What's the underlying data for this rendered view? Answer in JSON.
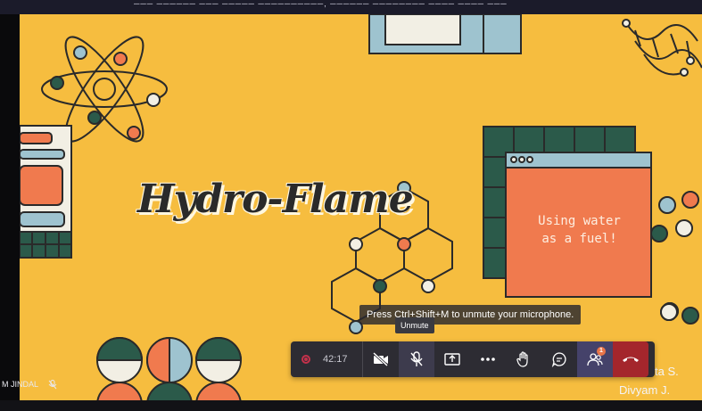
{
  "window": {
    "top_title": "─── ────── ─── ───── ──────────, ────── ──────── ──── ──── ───"
  },
  "slide": {
    "title": "Hydro-Flame",
    "card_line1": "Using water",
    "card_line2": "as a fuel!"
  },
  "tooltips": {
    "hint": "Press Ctrl+Shift+M to unmute your microphone.",
    "unmute": "Unmute"
  },
  "toolbar": {
    "timer": "42:17",
    "notification_count": "1",
    "buttons": [
      "record-indicator",
      "camera-off",
      "unmute",
      "share-screen",
      "more-actions",
      "raise-hand",
      "chat",
      "participants",
      "hang-up"
    ]
  },
  "participants": {
    "self_name": "M JINDAL",
    "other1": "ta S.",
    "other2": "Divyam J."
  },
  "colors": {
    "slide_bg": "#f6bd3f",
    "accent_orange": "#f07a4e",
    "dark_green": "#2b5a4a",
    "light_blue": "#9ec3cf",
    "toolbar_bg": "#2d2c33",
    "hangup_red": "#a4262c",
    "record_red": "#c4314b"
  }
}
